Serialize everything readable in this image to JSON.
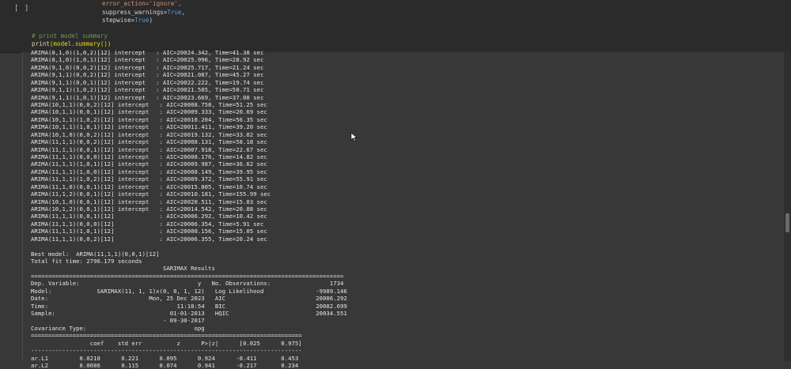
{
  "cell": {
    "run_indicator": "[ ]",
    "code": {
      "line1": "error_action='ignore',",
      "line2_pre": "suppress_warnings=",
      "line2_bool": "True",
      "line2_post": ",",
      "line3_pre": "stepwise=",
      "line3_bool": "True",
      "line3_post": ")",
      "comment": "# print model summary",
      "print_fn": "print",
      "print_arg": "(model.summary())"
    }
  },
  "output": {
    "lines": [
      "ARIMA(8,1,0)(1,0,2)[12] intercept   : AIC=20024.342, Time=41.38 sec",
      "ARIMA(8,1,0)(1,0,1)[12] intercept   : AIC=20025.996, Time=28.92 sec",
      "ARIMA(9,1,0)(0,0,2)[12] intercept   : AIC=20025.717, Time=21.24 sec",
      "ARIMA(9,1,1)(0,0,2)[12] intercept   : AIC=20021.087, Time=45.27 sec",
      "ARIMA(9,1,1)(0,0,1)[12] intercept   : AIC=20022.222, Time=19.74 sec",
      "ARIMA(9,1,1)(1,0,2)[12] intercept   : AIC=20021.585, Time=50.71 sec",
      "ARIMA(9,1,1)(1,0,1)[12] intercept   : AIC=20023.669, Time=37.08 sec",
      "ARIMA(10,1,1)(0,0,2)[12] intercept   : AIC=20008.758, Time=51.25 sec",
      "ARIMA(10,1,1)(0,0,1)[12] intercept   : AIC=20009.333, Time=20.69 sec",
      "ARIMA(10,1,1)(1,0,2)[12] intercept   : AIC=20010.204, Time=56.35 sec",
      "ARIMA(10,1,1)(1,0,1)[12] intercept   : AIC=20011.411, Time=39.20 sec",
      "ARIMA(10,1,0)(0,0,2)[12] intercept   : AIC=20019.132, Time=33.02 sec",
      "ARIMA(11,1,1)(0,0,2)[12] intercept   : AIC=20008.131, Time=58.18 sec",
      "ARIMA(11,1,1)(0,0,1)[12] intercept   : AIC=20007.918, Time=22.67 sec",
      "ARIMA(11,1,1)(0,0,0)[12] intercept   : AIC=20008.176, Time=14.82 sec",
      "ARIMA(11,1,1)(1,0,1)[12] intercept   : AIC=20009.987, Time=36.62 sec",
      "ARIMA(11,1,1)(1,0,0)[12] intercept   : AIC=20008.149, Time=39.95 sec",
      "ARIMA(11,1,1)(1,0,2)[12] intercept   : AIC=20009.372, Time=55.91 sec",
      "ARIMA(11,1,0)(0,0,1)[12] intercept   : AIC=20015.805, Time=10.74 sec",
      "ARIMA(11,1,2)(0,0,1)[12] intercept   : AIC=20010.181, Time=155.99 sec",
      "ARIMA(10,1,0)(0,0,1)[12] intercept   : AIC=20020.511, Time=15.03 sec",
      "ARIMA(10,1,2)(0,0,1)[12] intercept   : AIC=20014.542, Time=20.88 sec",
      "ARIMA(11,1,1)(0,0,1)[12]             : AIC=20006.292, Time=10.42 sec",
      "ARIMA(11,1,1)(0,0,0)[12]             : AIC=20006.354, Time=5.91 sec",
      "ARIMA(11,1,1)(1,0,1)[12]             : AIC=20008.156, Time=15.05 sec",
      "ARIMA(11,1,1)(0,0,2)[12]             : AIC=20006.355, Time=20.24 sec",
      "",
      "Best model:  ARIMA(11,1,1)(0,0,1)[12]",
      "Total fit time: 2796.179 seconds",
      "                                      SARIMAX Results",
      "==========================================================================================",
      "Dep. Variable:                                  y   No. Observations:                 1734",
      "Model:             SARIMAX(11, 1, 1)x(0, 0, 1, 12)   Log Likelihood               -9989.146",
      "Date:                             Mon, 25 Dec 2023   AIC                          20006.292",
      "Time:                                     11:18:54   BIC                          20082.699",
      "Sample:                                 01-01-2013   HQIC                         20034.551",
      "                                      - 09-30-2017",
      "Covariance Type:                               opg",
      "==============================================================================",
      "                 coef    std err          z      P>|z|      [0.025      0.975]",
      "------------------------------------------------------------------------------",
      "ar.L1         0.0210      0.221      0.095      0.924      -0.411       0.453",
      "ar.L2         0.0086      0.115      0.074      0.941      -0.217       0.234"
    ]
  }
}
